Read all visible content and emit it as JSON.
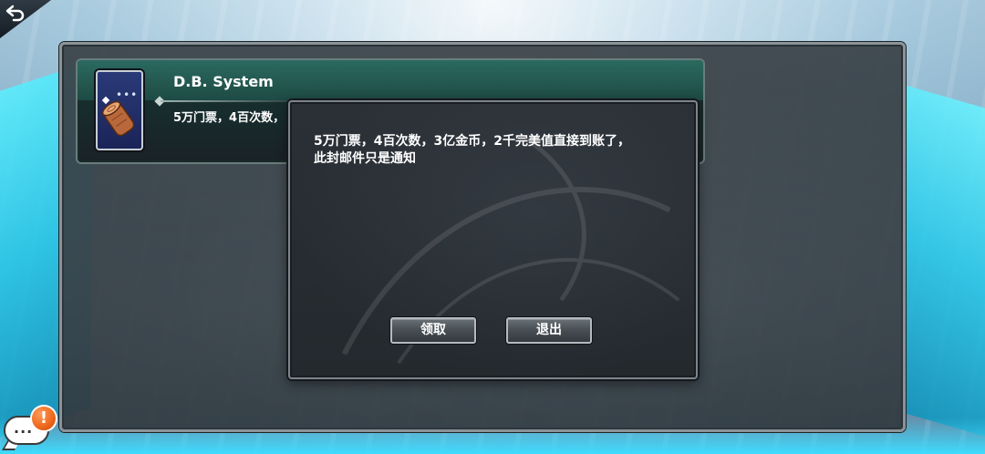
{
  "mail": {
    "sender": "D.B. System",
    "preview": "5万门票，4百次数，",
    "icon": "wood-log-gift-icon"
  },
  "dialog": {
    "message_line1": "5万门票，4百次数，3亿金币，2千完美值直接到账了，",
    "message_line2": "此封邮件只是通知",
    "claim_label": "领取",
    "exit_label": "退出"
  },
  "chat": {
    "dots": "...",
    "alert": "!"
  },
  "icons": {
    "back": "back-arrow-icon",
    "chat": "chat-bubble-icon",
    "alert": "exclamation-icon"
  },
  "colors": {
    "panel_border": "#8a9398",
    "mail_header": "#2b6a60",
    "button_border": "#b4bbc0",
    "alert_orange": "#f06b1f"
  }
}
